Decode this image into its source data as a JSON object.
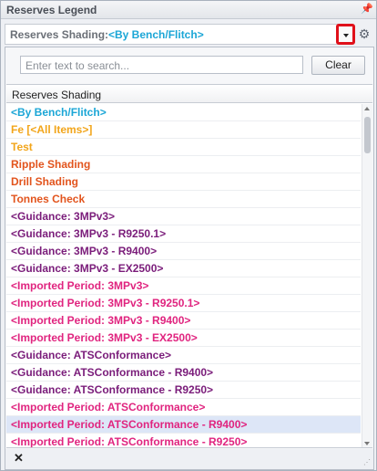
{
  "panel": {
    "title": "Reserves Legend",
    "pin_icon": "pin-icon"
  },
  "combo": {
    "label": "Reserves Shading:",
    "value": "<By Bench/Flitch>",
    "value_color": "#1ba6d6"
  },
  "search": {
    "placeholder": "Enter text to search...",
    "clear_label": "Clear"
  },
  "list": {
    "header": "Reserves Shading",
    "selected_index": 18,
    "items": [
      {
        "label": "<By Bench/Flitch>",
        "color": "#1ba6d6"
      },
      {
        "label": "Fe [<All Items>]",
        "color": "#f2a51a"
      },
      {
        "label": "Test",
        "color": "#f2a51a"
      },
      {
        "label": "Ripple Shading",
        "color": "#e2541d"
      },
      {
        "label": "Drill Shading",
        "color": "#e2541d"
      },
      {
        "label": "Tonnes Check",
        "color": "#e2541d"
      },
      {
        "label": "<Guidance: 3MPv3>",
        "color": "#7a1c7a"
      },
      {
        "label": "<Guidance: 3MPv3 - R9250.1>",
        "color": "#7a1c7a"
      },
      {
        "label": "<Guidance: 3MPv3 - R9400>",
        "color": "#7a1c7a"
      },
      {
        "label": "<Guidance: 3MPv3 - EX2500>",
        "color": "#7a1c7a"
      },
      {
        "label": "<Imported Period: 3MPv3>",
        "color": "#e0247f"
      },
      {
        "label": "<Imported Period: 3MPv3 - R9250.1>",
        "color": "#e0247f"
      },
      {
        "label": "<Imported Period: 3MPv3 - R9400>",
        "color": "#e0247f"
      },
      {
        "label": "<Imported Period: 3MPv3 - EX2500>",
        "color": "#e0247f"
      },
      {
        "label": "<Guidance: ATSConformance>",
        "color": "#7a1c7a"
      },
      {
        "label": "<Guidance: ATSConformance - R9400>",
        "color": "#7a1c7a"
      },
      {
        "label": "<Guidance: ATSConformance - R9250>",
        "color": "#7a1c7a"
      },
      {
        "label": "<Imported Period: ATSConformance>",
        "color": "#e0247f"
      },
      {
        "label": "<Imported Period: ATSConformance - R9400>",
        "color": "#e0247f"
      },
      {
        "label": "<Imported Period: ATSConformance - R9250>",
        "color": "#e0247f"
      }
    ]
  },
  "footer": {
    "close_glyph": "✕"
  }
}
